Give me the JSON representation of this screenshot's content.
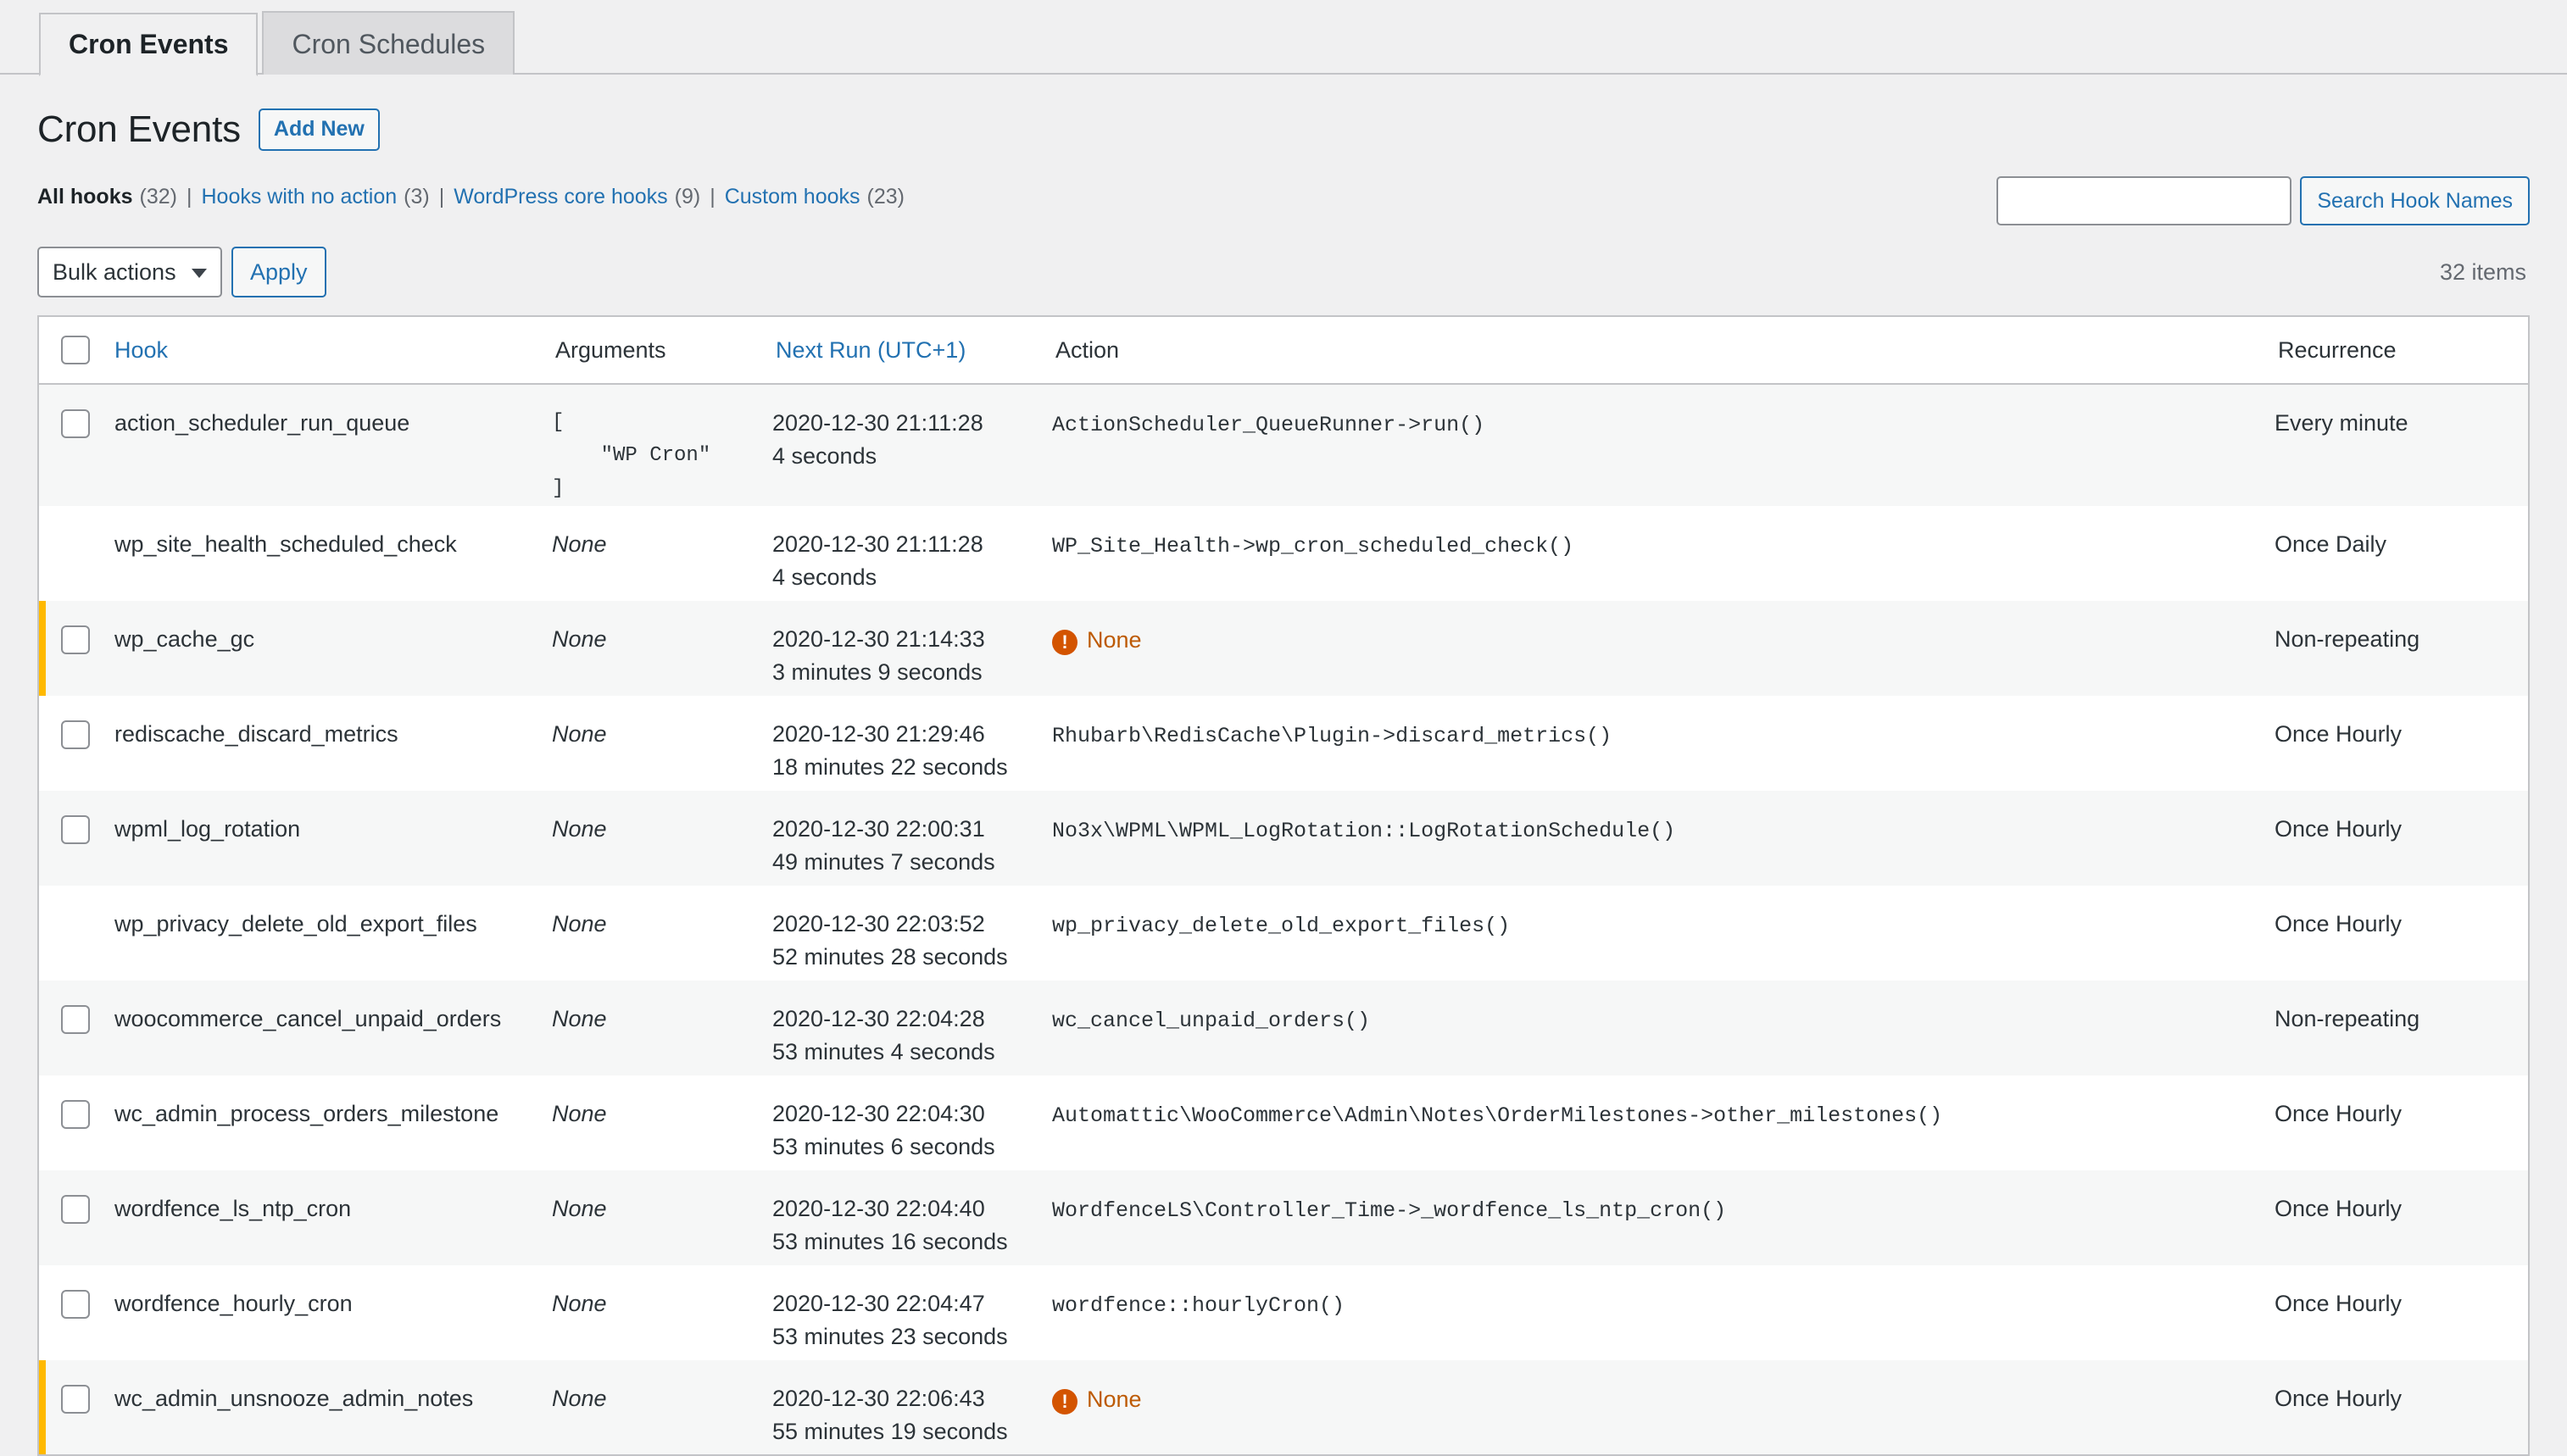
{
  "tabs": [
    {
      "label": "Cron Events",
      "active": true
    },
    {
      "label": "Cron Schedules",
      "active": false
    }
  ],
  "header": {
    "title": "Cron Events",
    "add_new_label": "Add New"
  },
  "filters": {
    "all_hooks_label": "All hooks",
    "all_hooks_count": "(32)",
    "no_action_label": "Hooks with no action",
    "no_action_count": "(3)",
    "core_hooks_label": "WordPress core hooks",
    "core_hooks_count": "(9)",
    "custom_hooks_label": "Custom hooks",
    "custom_hooks_count": "(23)",
    "separator": "|"
  },
  "search": {
    "value": "",
    "placeholder": "",
    "button_label": "Search Hook Names"
  },
  "tablenav": {
    "bulk_actions_label": "Bulk actions",
    "apply_label": "Apply",
    "displaying_num": "32 items"
  },
  "table": {
    "columns": {
      "hook": "Hook",
      "arguments": "Arguments",
      "next_run": "Next Run (UTC+1)",
      "action": "Action",
      "recurrence": "Recurrence"
    },
    "rows": [
      {
        "checkbox": true,
        "hook": "action_scheduler_run_queue",
        "args_type": "code",
        "args": "[\n    \"WP Cron\"\n]",
        "next_run_stamp": "2020-12-30 21:11:28",
        "next_run_rel": "4 seconds",
        "action_type": "code",
        "action": "ActionScheduler_QueueRunner->run()",
        "recurrence": "Every minute",
        "warning": false,
        "alt": true
      },
      {
        "checkbox": false,
        "hook": "wp_site_health_scheduled_check",
        "args_type": "none",
        "args": "None",
        "next_run_stamp": "2020-12-30 21:11:28",
        "next_run_rel": "4 seconds",
        "action_type": "code",
        "action": "WP_Site_Health->wp_cron_scheduled_check()",
        "recurrence": "Once Daily",
        "warning": false,
        "alt": false
      },
      {
        "checkbox": true,
        "hook": "wp_cache_gc",
        "args_type": "none",
        "args": "None",
        "next_run_stamp": "2020-12-30 21:14:33",
        "next_run_rel": "3 minutes 9 seconds",
        "action_type": "none",
        "action": "None",
        "recurrence": "Non-repeating",
        "warning": true,
        "alt": true
      },
      {
        "checkbox": true,
        "hook": "rediscache_discard_metrics",
        "args_type": "none",
        "args": "None",
        "next_run_stamp": "2020-12-30 21:29:46",
        "next_run_rel": "18 minutes 22 seconds",
        "action_type": "code",
        "action": "Rhubarb\\RedisCache\\Plugin->discard_metrics()",
        "recurrence": "Once Hourly",
        "warning": false,
        "alt": false
      },
      {
        "checkbox": true,
        "hook": "wpml_log_rotation",
        "args_type": "none",
        "args": "None",
        "next_run_stamp": "2020-12-30 22:00:31",
        "next_run_rel": "49 minutes 7 seconds",
        "action_type": "code",
        "action": "No3x\\WPML\\WPML_LogRotation::LogRotationSchedule()",
        "recurrence": "Once Hourly",
        "warning": false,
        "alt": true
      },
      {
        "checkbox": false,
        "hook": "wp_privacy_delete_old_export_files",
        "args_type": "none",
        "args": "None",
        "next_run_stamp": "2020-12-30 22:03:52",
        "next_run_rel": "52 minutes 28 seconds",
        "action_type": "code",
        "action": "wp_privacy_delete_old_export_files()",
        "recurrence": "Once Hourly",
        "warning": false,
        "alt": false
      },
      {
        "checkbox": true,
        "hook": "woocommerce_cancel_unpaid_orders",
        "args_type": "none",
        "args": "None",
        "next_run_stamp": "2020-12-30 22:04:28",
        "next_run_rel": "53 minutes 4 seconds",
        "action_type": "code",
        "action": "wc_cancel_unpaid_orders()",
        "recurrence": "Non-repeating",
        "warning": false,
        "alt": true
      },
      {
        "checkbox": true,
        "hook": "wc_admin_process_orders_milestone",
        "args_type": "none",
        "args": "None",
        "next_run_stamp": "2020-12-30 22:04:30",
        "next_run_rel": "53 minutes 6 seconds",
        "action_type": "code",
        "action": "Automattic\\WooCommerce\\Admin\\Notes\\OrderMilestones->other_milestones()",
        "recurrence": "Once Hourly",
        "warning": false,
        "alt": false
      },
      {
        "checkbox": true,
        "hook": "wordfence_ls_ntp_cron",
        "args_type": "none",
        "args": "None",
        "next_run_stamp": "2020-12-30 22:04:40",
        "next_run_rel": "53 minutes 16 seconds",
        "action_type": "code",
        "action": "WordfenceLS\\Controller_Time->_wordfence_ls_ntp_cron()",
        "recurrence": "Once Hourly",
        "warning": false,
        "alt": true
      },
      {
        "checkbox": true,
        "hook": "wordfence_hourly_cron",
        "args_type": "none",
        "args": "None",
        "next_run_stamp": "2020-12-30 22:04:47",
        "next_run_rel": "53 minutes 23 seconds",
        "action_type": "code",
        "action": "wordfence::hourlyCron()",
        "recurrence": "Once Hourly",
        "warning": false,
        "alt": false
      },
      {
        "checkbox": true,
        "hook": "wc_admin_unsnooze_admin_notes",
        "args_type": "none",
        "args": "None",
        "next_run_stamp": "2020-12-30 22:06:43",
        "next_run_rel": "55 minutes 19 seconds",
        "action_type": "none",
        "action": "None",
        "recurrence": "Once Hourly",
        "warning": true,
        "alt": true
      }
    ]
  },
  "colors": {
    "link": "#2271b1",
    "warning_border": "#ffb900",
    "warning_icon": "#d35400",
    "warning_text": "#bd5a04",
    "page_bg": "#f0f0f1"
  },
  "icons": {
    "warning": "!",
    "chevron_down": "chevron-down-icon"
  }
}
